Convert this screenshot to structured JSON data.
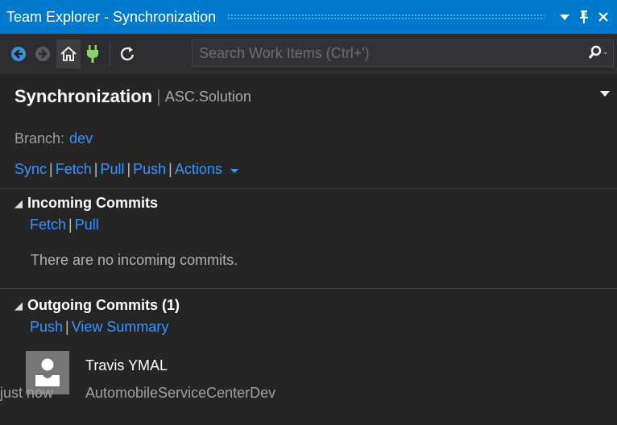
{
  "window": {
    "title": "Team Explorer - Synchronization",
    "dropdown_icon": "caret-down-icon",
    "pin_icon": "pin-icon",
    "close_icon": "close-icon"
  },
  "toolbar": {
    "back_icon": "back-icon",
    "forward_icon": "forward-icon",
    "home_icon": "home-icon",
    "connect_icon": "plug-icon",
    "refresh_icon": "refresh-icon",
    "search_placeholder": "Search Work Items (Ctrl+')",
    "search_icon": "search-icon"
  },
  "header": {
    "page_title": "Synchronization",
    "separator": "|",
    "solution": "ASC.Solution"
  },
  "branch": {
    "label": "Branch:",
    "value": "dev"
  },
  "actions": {
    "sync": "Sync",
    "fetch": "Fetch",
    "pull": "Pull",
    "push": "Push",
    "actions": "Actions"
  },
  "incoming": {
    "heading": "Incoming Commits",
    "fetch": "Fetch",
    "pull": "Pull",
    "empty_message": "There are no incoming commits."
  },
  "outgoing": {
    "heading": "Outgoing Commits (1)",
    "push": "Push",
    "view_summary": "View Summary",
    "commits": [
      {
        "author": "Travis YMAL",
        "message": "AutomobileServiceCenterDev",
        "time": "just now"
      }
    ]
  },
  "colors": {
    "accent": "#007acc",
    "link": "#3794ff",
    "background": "#252526"
  },
  "link_separator": "|"
}
